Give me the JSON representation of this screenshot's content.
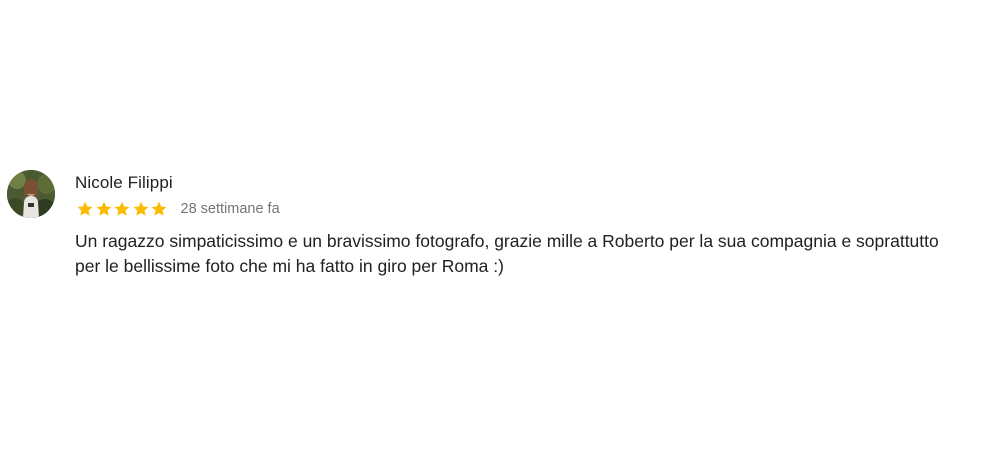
{
  "review": {
    "author": "Nicole Filippi",
    "rating": 5,
    "rating_max": 5,
    "date": "28 settimane fa",
    "text_lines": [
      "Un ragazzo simpaticissimo e un bravissimo fotografo, grazie mille a Roberto per la sua compagnia e soprattutto",
      "per le bellissime foto che mi ha fatto in giro per Roma :)"
    ],
    "star_color": "#fbbc04",
    "avatar_icon": "user-photo-avatar"
  }
}
